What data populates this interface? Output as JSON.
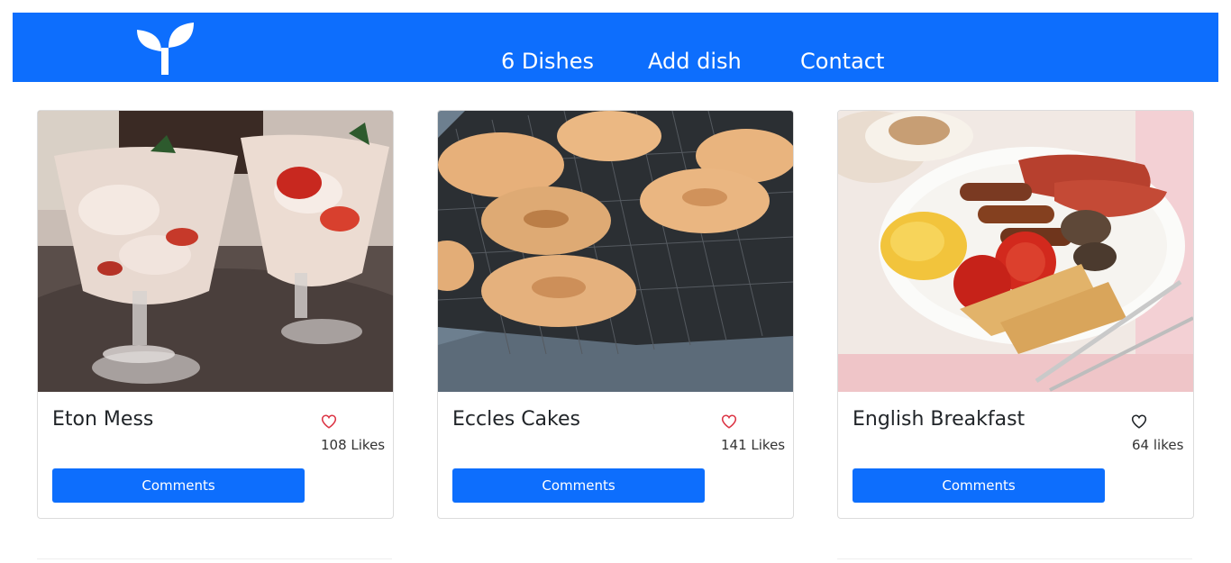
{
  "nav": {
    "logo_icon": "sprout-icon",
    "links": [
      "6 Dishes",
      "Add dish",
      "Contact"
    ]
  },
  "colors": {
    "primary": "#0d6efd",
    "heart_liked": "#dc3545",
    "heart_default": "#212529"
  },
  "dishes": [
    {
      "name": "Eton Mess",
      "likes": "108 Likes",
      "button": "Comments",
      "liked": true,
      "image": "eton-mess-photo"
    },
    {
      "name": "Eccles Cakes",
      "likes": "141 Likes",
      "button": "Comments",
      "liked": true,
      "image": "eccles-cakes-photo"
    },
    {
      "name": "English Breakfast",
      "likes": "64 likes",
      "button": "Comments",
      "liked": false,
      "image": "english-breakfast-photo"
    }
  ]
}
